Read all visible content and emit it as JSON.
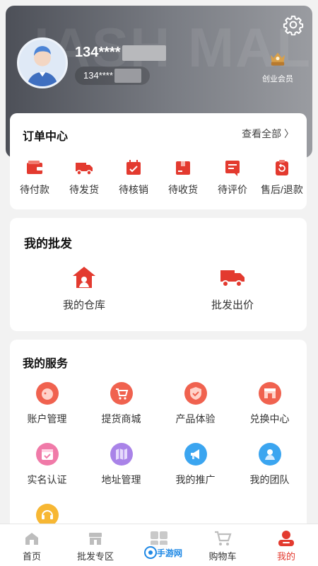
{
  "header": {
    "watermark": "IASH MALL",
    "phone": "134****",
    "phone_small": "134****",
    "member_label": "创业会员",
    "settings_icon": "gear-icon"
  },
  "orders": {
    "title": "订单中心",
    "view_all": "查看全部 〉",
    "items": [
      {
        "label": "待付款",
        "icon": "wallet-icon"
      },
      {
        "label": "待发货",
        "icon": "truck-icon"
      },
      {
        "label": "待核销",
        "icon": "calendar-check-icon"
      },
      {
        "label": "待收货",
        "icon": "box-icon"
      },
      {
        "label": "待评价",
        "icon": "review-icon"
      },
      {
        "label": "售后/退款",
        "icon": "refund-icon"
      }
    ]
  },
  "wholesale": {
    "title": "我的批发",
    "items": [
      {
        "label": "我的仓库",
        "icon": "warehouse-icon"
      },
      {
        "label": "批发出价",
        "icon": "truck-icon"
      }
    ]
  },
  "services": {
    "title": "我的服务",
    "items": [
      {
        "label": "账户管理",
        "icon": "piggy-bank-icon",
        "color": "#f0624f"
      },
      {
        "label": "提货商城",
        "icon": "cart-icon",
        "color": "#f0624f"
      },
      {
        "label": "产品体验",
        "icon": "shield-icon",
        "color": "#f0624f"
      },
      {
        "label": "兑换中心",
        "icon": "shop-icon",
        "color": "#f0624f"
      },
      {
        "label": "实名认证",
        "icon": "calendar-icon",
        "color": "#f07aa8"
      },
      {
        "label": "地址管理",
        "icon": "map-icon",
        "color": "#a983e8"
      },
      {
        "label": "我的推广",
        "icon": "megaphone-icon",
        "color": "#3ba5f0"
      },
      {
        "label": "我的团队",
        "icon": "team-icon",
        "color": "#3ba5f0"
      },
      {
        "label": "",
        "icon": "service-icon",
        "color": "#f7b733"
      }
    ]
  },
  "tabbar": {
    "items": [
      {
        "label": "首页",
        "icon": "home-icon"
      },
      {
        "label": "批发专区",
        "icon": "store-icon"
      },
      {
        "label": "",
        "icon": "grid-icon"
      },
      {
        "label": "购物车",
        "icon": "cart-icon"
      },
      {
        "label": "我的",
        "icon": "user-icon",
        "active": true
      }
    ],
    "watermark_text": "手游网"
  },
  "colors": {
    "accent": "#e33a2f",
    "hero_dark": "#4d5058"
  }
}
